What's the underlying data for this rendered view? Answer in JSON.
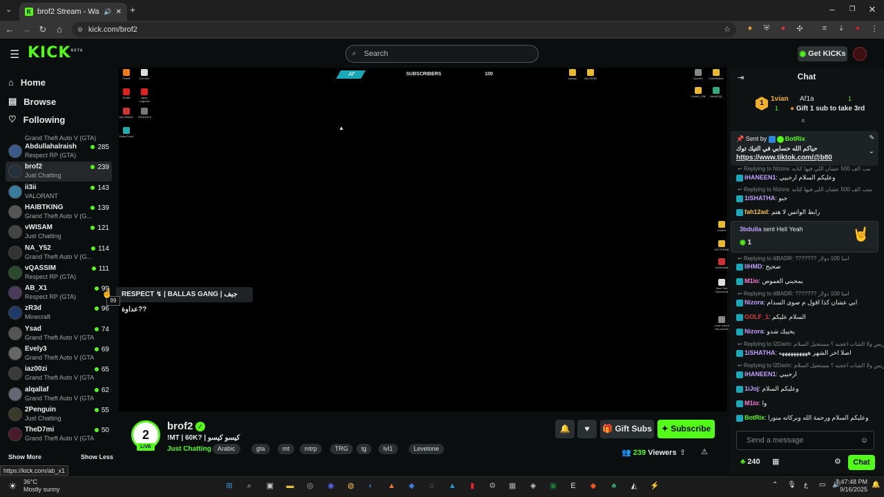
{
  "browser": {
    "tab_title": "brof2 Stream - Watch Live o",
    "url": "kick.com/brof2",
    "status_url": "https://kick.com/ab_x1"
  },
  "header": {
    "logo": "KICK",
    "logo_badge": "BETA",
    "search_placeholder": "Search",
    "get_kicks": "Get KICKs"
  },
  "nav": {
    "home": "Home",
    "browse": "Browse",
    "following": "Following"
  },
  "sidebar": {
    "partial_category": "Grand Theft Auto V (GTA)",
    "channels": [
      {
        "name": "Abdullahalraish",
        "category": "Respect RP (GTA)",
        "viewers": "285"
      },
      {
        "name": "brof2",
        "category": "Just Chatting",
        "viewers": "239"
      },
      {
        "name": "ii3ii",
        "category": "VALORANT",
        "viewers": "143"
      },
      {
        "name": "HAIBTKING",
        "category": "Grand Theft Auto V (G...",
        "viewers": "139"
      },
      {
        "name": "vWISAM",
        "category": "Just Chatting",
        "viewers": "121"
      },
      {
        "name": "NA_Y52",
        "category": "Grand Theft Auto V (G...",
        "viewers": "114"
      },
      {
        "name": "vQASSIM",
        "category": "Respect RP (GTA)",
        "viewers": "111"
      },
      {
        "name": "AB_X1",
        "category": "Respect RP (GTA)",
        "viewers": "99"
      },
      {
        "name": "zR3d",
        "category": "Minecraft",
        "viewers": "96"
      },
      {
        "name": "Ysad",
        "category": "Grand Theft Auto V (GTA)",
        "viewers": "74"
      },
      {
        "name": "Evely3",
        "category": "Grand Theft Auto V (GTA)",
        "viewers": "69"
      },
      {
        "name": "iaz00zi",
        "category": "Grand Theft Auto V (GTA)",
        "viewers": "65"
      },
      {
        "name": "alqallaf",
        "category": "Grand Theft Auto V (GTA)",
        "viewers": "62"
      },
      {
        "name": "2Penguin",
        "category": "Just Chatting",
        "viewers": "55"
      },
      {
        "name": "TheD7mi",
        "category": "Grand Theft Auto V (GTA)",
        "viewers": "50"
      }
    ],
    "show_more": "Show More",
    "show_less": "Show Less",
    "tooltip": "RESPECT ↯ | BALLAS GANG | جيف عداوة??",
    "tooltip_count": "99"
  },
  "video": {
    "overlay_num": "12",
    "overlay_label": "SUBSCRIBERS",
    "overlay_goal": "100",
    "desktop_left": [
      "FiveM",
      "Car Dev",
      "RedM",
      "Apex Legends",
      "VALORANT",
      "TEKKEN 8",
      "Delta Force"
    ],
    "desktop_top": [
      "backup",
      "VALORAS"
    ],
    "desktop_right": [
      "OpenIV",
      "CodeWalker",
      "CodeX_SIB",
      "HexMSQL",
      "brofret",
      "PATTERNS",
      "bs33mb3d",
      "New Text Document",
      "Learn about this picture"
    ]
  },
  "stream": {
    "avatar_text": "2",
    "live": "LIVE",
    "name": "brof2",
    "title": "!MT | 60K? | كيسو كيسو",
    "category": "Just Chatting",
    "tags": [
      "Arabic",
      "gta",
      "mt",
      "mtrp",
      "TRG",
      "tg",
      "lvl1",
      "Levelone"
    ],
    "gift_subs": "Gift Subs",
    "subscribe": "Subscribe",
    "viewers_count": "239",
    "viewers_label": "Viewers"
  },
  "chat": {
    "title": "Chat",
    "leader1_name": "1vian",
    "leader1_count": "1",
    "leader2_name": "Af1a",
    "leader2_count": "1",
    "gift_prompt": "Gift 1 sub to take 3rd",
    "pinned_by": "Sent by",
    "pinned_user": "BotRix",
    "pinned_text": "حياكم الله حسابي في التيك توك",
    "pinned_link": "https://www.tiktok.com/@b80",
    "sent_card_user": "3bdulla",
    "sent_card_text": "sent Hell Yeah",
    "sent_card_count": "1",
    "messages": [
      {
        "reply": "Replying to Nizora: مب الف 500 عشان اللي فيها كتابه",
        "user": "",
        "text": ""
      },
      {
        "reply": "",
        "user": "iHANEEN1",
        "text": "وعليكم السلام ارحبيي"
      },
      {
        "reply": "Replying to Nizora: منب الف 500 عشان اللي فيها كتابه",
        "user": "",
        "text": ""
      },
      {
        "reply": "",
        "user": "1iSHATHA",
        "text": "حبو"
      },
      {
        "reply": "",
        "user": "fah12ad",
        "text": "رابط الواتس لا هتم"
      },
      {
        "reply": "Replying to iiiBADR: ??????? امبا 100 دولار",
        "user": "IIHMD",
        "text": "صحيح"
      },
      {
        "reply": "",
        "user": "M1io",
        "text": "يمجبني العموص"
      },
      {
        "reply": "Replying to iiiBADR: ??????? امبا 100 دولار",
        "user": "Nizora",
        "text": "ابي عشان كذا اقول م صوى السدام"
      },
      {
        "reply": "",
        "user": "GOLF_1",
        "text": "السلام عليكم"
      },
      {
        "reply": "",
        "user": "Nizora",
        "text": "يحييك شدو"
      },
      {
        "reply": "Replying to I2Darin: مو ريس ولا الشات اعجبه ؟ مستحيل السلام",
        "user": "1iSHATHA",
        "text": "اصلا اخر الشهر ههههههههههه"
      },
      {
        "reply": "Replying to I2Darin: مو ريس ولا الشات اعجبه ؟ مستحيل السلام",
        "user": "iHANEEN1",
        "text": "ارحبيي"
      },
      {
        "reply": "",
        "user": "1iJoj",
        "text": "وعليكم السلام"
      },
      {
        "reply": "",
        "user": "M1io",
        "text": "وا"
      },
      {
        "reply": "",
        "user": "BotRix",
        "text": "وعليكم السلام ورحمة الله وبركاته منورا"
      }
    ],
    "input_placeholder": "Send a message",
    "points": "240",
    "send": "Chat"
  },
  "taskbar": {
    "temp": "36°C",
    "weather": "Mostly sunny",
    "time": "7:47:48 PM",
    "date": "9/16/2025"
  },
  "colors": {
    "accent": "#53fc18",
    "bg": "#0b0e0f"
  }
}
